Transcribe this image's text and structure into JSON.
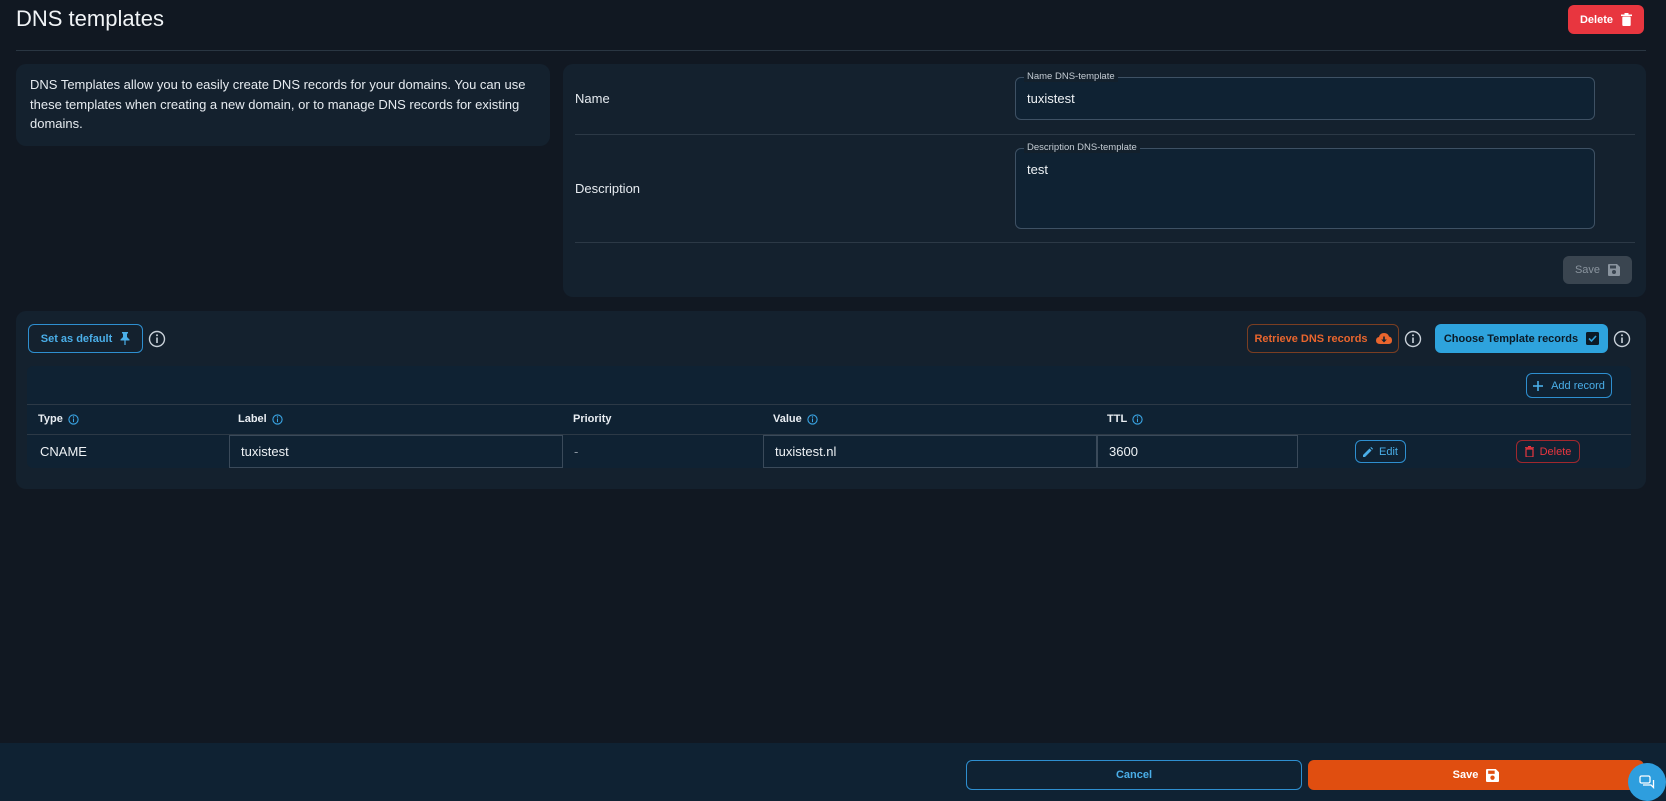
{
  "header": {
    "title": "DNS templates",
    "delete_label": "Delete"
  },
  "intro": {
    "text": "DNS Templates allow you to easily create DNS records for your domains. You can use these templates when creating a new domain, or to manage DNS records for existing domains."
  },
  "form": {
    "name_row_label": "Name",
    "name_field_label": "Name DNS-template",
    "name_value": "tuxistest",
    "description_row_label": "Description",
    "description_field_label": "Description DNS-template",
    "description_value": "test",
    "save_label": "Save"
  },
  "records": {
    "set_default_label": "Set as default",
    "retrieve_label": "Retrieve DNS records",
    "choose_template_label": "Choose Template records",
    "add_record_label": "Add record",
    "columns": {
      "type": "Type",
      "label": "Label",
      "priority": "Priority",
      "value": "Value",
      "ttl": "TTL"
    },
    "rows": [
      {
        "type": "CNAME",
        "label": "tuxistest",
        "priority": "-",
        "value": "tuxistest.nl",
        "ttl": "3600",
        "edit_label": "Edit",
        "delete_label": "Delete"
      }
    ]
  },
  "footer": {
    "cancel_label": "Cancel",
    "save_label": "Save"
  },
  "colors": {
    "accent_blue": "#2ea3dd",
    "accent_orange": "#e04e10",
    "danger_red": "#e8363f",
    "background": "#111822"
  },
  "icons": [
    "trash-icon",
    "floppy-disk-icon",
    "pin-icon",
    "info-icon",
    "cloud-download-icon",
    "checkbox-icon",
    "plus-icon",
    "pencil-icon",
    "chat-icon"
  ]
}
